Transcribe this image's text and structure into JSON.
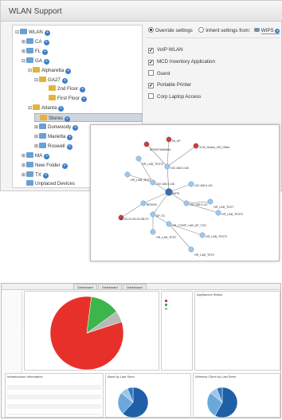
{
  "wlan_support": {
    "title": "WLAN Support",
    "tree": [
      {
        "label": "WLAN",
        "kind": "root",
        "twist": "⊟"
      },
      {
        "label": "CA",
        "kind": "site",
        "twist": "⊞"
      },
      {
        "label": "FL",
        "kind": "site",
        "twist": "⊞"
      },
      {
        "label": "GA",
        "kind": "site",
        "twist": "⊟"
      },
      {
        "label": "Alpharetta",
        "kind": "folder",
        "twist": "⊟"
      },
      {
        "label": "GA27",
        "kind": "folder",
        "twist": "⊟"
      },
      {
        "label": "2nd Floor",
        "kind": "folder",
        "twist": ""
      },
      {
        "label": "First Floor",
        "kind": "folder",
        "twist": ""
      },
      {
        "label": "Atlanta",
        "kind": "folder",
        "twist": "⊟"
      },
      {
        "label": "Stores",
        "kind": "folder",
        "twist": "",
        "selected": true
      },
      {
        "label": "Dunwoody",
        "kind": "site",
        "twist": "⊞"
      },
      {
        "label": "Marietta",
        "kind": "site",
        "twist": "⊞"
      },
      {
        "label": "Roswell",
        "kind": "site",
        "twist": "⊞"
      },
      {
        "label": "MA",
        "kind": "site",
        "twist": "⊞"
      },
      {
        "label": "New Folder",
        "kind": "site",
        "twist": "⊞"
      },
      {
        "label": "TX",
        "kind": "site",
        "twist": "⊞"
      },
      {
        "label": "Unplaced Devices",
        "kind": "device",
        "twist": ""
      }
    ],
    "override_label": "Override settings",
    "inherit_label": "Inherit settings from:",
    "inherit_value": "WIPS",
    "ssids": [
      {
        "label": "VoIP WLAN",
        "checked": true
      },
      {
        "label": "MCD Inventory Application",
        "checked": true
      },
      {
        "label": "Guest",
        "checked": false
      },
      {
        "label": "Portable Printer",
        "checked": true
      },
      {
        "label": "Corp Laptop Access",
        "checked": false
      }
    ]
  },
  "topology": {
    "nodes": [
      {
        "label": "AP9007ficf50fb4",
        "kind": "ap"
      },
      {
        "label": "06_AP",
        "kind": "ap"
      },
      {
        "label": "1130_Seans_HR_Office",
        "kind": "ap"
      },
      {
        "label": "HR_LAB_TEST2",
        "kind": "ap"
      },
      {
        "label": "192.168.0.140",
        "kind": "switch"
      },
      {
        "label": "HR_LAB_TEST",
        "kind": "ap"
      },
      {
        "label": "192.168.0.146",
        "kind": "switch"
      },
      {
        "label": "WIPS",
        "kind": "core"
      },
      {
        "label": "192.168.0.101",
        "kind": "switch"
      },
      {
        "label": "BR0000",
        "kind": "switch"
      },
      {
        "label": "192.168.0.147",
        "kind": "switch"
      },
      {
        "label": "HR_LAB_TEST",
        "kind": "ap"
      },
      {
        "label": "AP-00-23-05-04-0B-F0",
        "kind": "ap"
      },
      {
        "label": "AP-TO",
        "kind": "ap"
      },
      {
        "label": "HR_COMP_LAB_AP_TCD",
        "kind": "ap"
      },
      {
        "label": "HR_LAB_TEST2",
        "kind": "ap"
      },
      {
        "label": "HR_LAB_TEST",
        "kind": "ap"
      },
      {
        "label": "HR_LAB_TEST2",
        "kind": "ap"
      },
      {
        "label": "HR_LAB_TEST",
        "kind": "ap"
      }
    ]
  },
  "dashboard": {
    "tabs": [
      "Dashboard",
      "Dashboard",
      "Dashboard"
    ],
    "appliances_title": "Appliances Status",
    "infra_title": "Infrastructure Information",
    "band_title": "Band by Last Seen",
    "wireless_title": "Wireless Client by Last Seen",
    "colors": {
      "red": "#e8302a",
      "green": "#3cb64a",
      "grey": "#b9b9b9",
      "blue": "#1f5fa8"
    }
  },
  "chart_data": [
    {
      "type": "pie",
      "title": "",
      "labels": [
        "",
        "",
        ""
      ],
      "values": [
        82,
        13,
        5
      ],
      "colors": [
        "#e8302a",
        "#3cb64a",
        "#b9b9b9"
      ]
    },
    {
      "type": "pie",
      "title": "Band by Last Seen",
      "values": [
        62,
        24,
        8,
        6
      ],
      "colors": [
        "#1f5fa8",
        "#6aa8dc",
        "#9bc7ea",
        "#2f79c6"
      ]
    },
    {
      "type": "pie",
      "title": "Wireless Client by Last Seen",
      "values": [
        58,
        28,
        8,
        6
      ],
      "colors": [
        "#1f5fa8",
        "#6aa8dc",
        "#9bc7ea",
        "#2f79c6"
      ]
    }
  ]
}
